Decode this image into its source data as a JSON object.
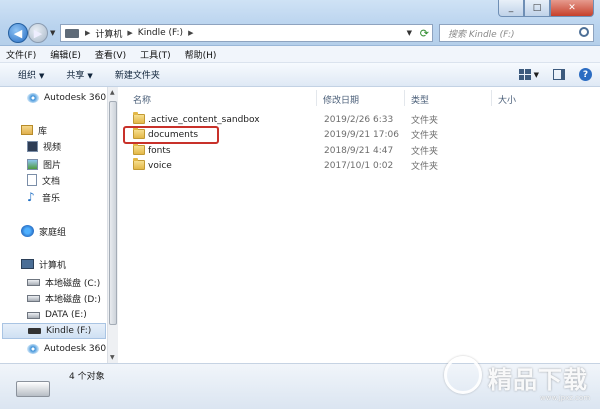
{
  "address": {
    "crumbs": [
      "计算机",
      "Kindle (F:)"
    ]
  },
  "search": {
    "placeholder": "搜索 Kindle (F:)"
  },
  "menubar": {
    "items": [
      "文件(F)",
      "编辑(E)",
      "查看(V)",
      "工具(T)",
      "帮助(H)"
    ]
  },
  "toolbar": {
    "organize": "组织",
    "share": "共享",
    "new_folder": "新建文件夹"
  },
  "nav": {
    "items": [
      {
        "label": "Autodesk 360",
        "icon": "autodesk-icon"
      },
      {
        "label": "库",
        "icon": "library-icon"
      },
      {
        "label": "视频",
        "icon": "video-icon"
      },
      {
        "label": "图片",
        "icon": "picture-icon"
      },
      {
        "label": "文档",
        "icon": "document-icon"
      },
      {
        "label": "音乐",
        "icon": "music-icon"
      },
      {
        "label": "家庭组",
        "icon": "homegroup-icon"
      },
      {
        "label": "计算机",
        "icon": "computer-icon"
      },
      {
        "label": "本地磁盘 (C:)",
        "icon": "drive-icon"
      },
      {
        "label": "本地磁盘 (D:)",
        "icon": "drive-icon"
      },
      {
        "label": "DATA (E:)",
        "icon": "drive-icon"
      },
      {
        "label": "Kindle (F:)",
        "icon": "kindle-icon"
      },
      {
        "label": "Autodesk 360",
        "icon": "autodesk-icon"
      }
    ]
  },
  "columns": {
    "name": "名称",
    "date": "修改日期",
    "type": "类型",
    "size": "大小"
  },
  "files": [
    {
      "name": ".active_content_sandbox",
      "date": "2019/2/26 6:33",
      "type": "文件夹"
    },
    {
      "name": "documents",
      "date": "2019/9/21 17:06",
      "type": "文件夹"
    },
    {
      "name": "fonts",
      "date": "2018/9/21 4:47",
      "type": "文件夹"
    },
    {
      "name": "voice",
      "date": "2017/10/1 0:02",
      "type": "文件夹"
    }
  ],
  "status": {
    "count": "4 个对象"
  },
  "watermark": {
    "text": "精品下载",
    "url": "www.jpxz.com"
  }
}
